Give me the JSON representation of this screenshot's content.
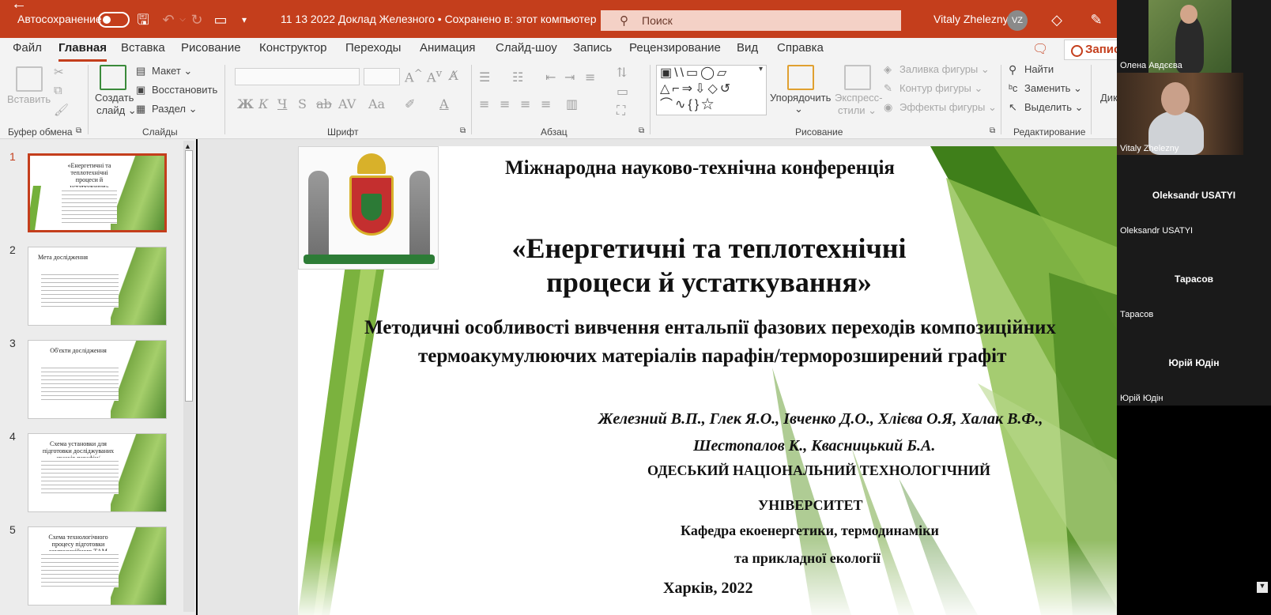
{
  "titlebar": {
    "autosave_label": "Автосохранение",
    "doc_title": "11 13 2022 Доклад Железного  •  Сохранено в: этот компьютер",
    "doc_title_chevron": "⌵",
    "search_placeholder": "Поиск",
    "user_name": "Vitaly Zheleznу",
    "user_initials": "VZ",
    "back_arrow": "←"
  },
  "tabs": [
    {
      "label": "Файл"
    },
    {
      "label": "Главная"
    },
    {
      "label": "Вставка"
    },
    {
      "label": "Рисование"
    },
    {
      "label": "Конструктор"
    },
    {
      "label": "Переходы"
    },
    {
      "label": "Анимация"
    },
    {
      "label": "Слайд-шоу"
    },
    {
      "label": "Запись"
    },
    {
      "label": "Рецензирование"
    },
    {
      "label": "Вид"
    },
    {
      "label": "Справка"
    }
  ],
  "record_button": "Запись",
  "ribbon": {
    "clipboard": {
      "paste": "Вставить",
      "group": "Буфер обмена"
    },
    "slides": {
      "new_slide_1": "Создать",
      "new_slide_2": "слайд ⌄",
      "layout": "Макет ⌄",
      "reset": "Восстановить",
      "section": "Раздел ⌄",
      "group": "Слайды"
    },
    "font": {
      "group": "Шрифт"
    },
    "paragraph": {
      "group": "Абзац"
    },
    "drawing": {
      "arrange_1": "Упорядочить",
      "arrange_2": "⌄",
      "quick_styles_1": "Экспресс-",
      "quick_styles_2": "стили ⌄",
      "fill": "Заливка фигуры ⌄",
      "outline": "Контур фигуры ⌄",
      "effects": "Эффекты фигуры ⌄",
      "group": "Рисование"
    },
    "editing": {
      "find": "Найти",
      "replace": "Заменить ⌄",
      "select": "Выделить ⌄",
      "group": "Редактирование"
    },
    "overflow": "Дик"
  },
  "thumbnails": [
    {
      "number": "1",
      "title": "«Енергетичні та теплотехнічні процеси й устаткування»",
      "selected": true
    },
    {
      "number": "2",
      "title": "Мета дослідження",
      "selected": false
    },
    {
      "number": "3",
      "title": "Об'єкти дослідження",
      "selected": false
    },
    {
      "number": "4",
      "title": "Схема установки для підготовки досліджуваних зразків парафін/терморозширений графіт",
      "selected": false
    },
    {
      "number": "5",
      "title": "Схема технологічного процесу підготовки композиційного ТАМ парафін ТРГ",
      "selected": false
    }
  ],
  "slide": {
    "conference": "Міжнародна  науково-технічна конференція",
    "title_line1": "«Енергетичні та теплотехнічні",
    "title_line2": "процеси й устаткування»",
    "subtitle_line1": "Методичні особливості вивчення ентальпії фазових переходів композиційних",
    "subtitle_line2": "термоакумулюючих матеріалів парафін/терморозширений графіт",
    "authors_line1": "Железний В.П., Глек Я.О., Івченко Д.О., Хлієва О.Я, Халак В.Ф.,",
    "authors_line2": "Шестопалов К., Квасницький Б.А.",
    "university_line1": "ОДЕСЬКИЙ НАЦІОНАЛЬНИЙ ТЕХНОЛОГІЧНИЙ",
    "university_line2": "УНІВЕРСИТЕТ",
    "department_line1": "Кафедра екоенергетики, термодинаміки",
    "department_line2": "та прикладної екології",
    "city_year": "Харків, 2022"
  },
  "participants": [
    {
      "name": "Олена Авдєєва",
      "video": true
    },
    {
      "name": "Vitaly Zheleznу",
      "video": true
    },
    {
      "name": "Oleksandr USATYI",
      "video": false
    },
    {
      "name": "Тарасов",
      "video": false
    },
    {
      "name": "Юрій Юдін",
      "video": false
    }
  ],
  "colors": {
    "accent": "#c43e1c",
    "ribbon_bg": "#f3f3f3",
    "slide_green": "#5f9a2a"
  }
}
